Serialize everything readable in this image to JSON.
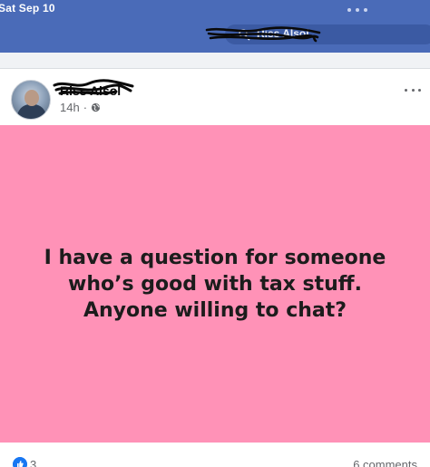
{
  "status_bar": {
    "date": "Sat Sep 10"
  },
  "header": {
    "search_text": "Riss Alsol"
  },
  "post": {
    "author_name": "Riss Alsol",
    "time": "14h",
    "separator": "·",
    "text": "I have a question for someone who’s good with tax stuff. Anyone willing to chat?",
    "background_color": "#ff92b7",
    "reaction_count": "3",
    "comment_count": "6 comments"
  },
  "icons": {
    "audience": "globe-icon",
    "reaction": "like-icon",
    "menu": "more-icon"
  }
}
